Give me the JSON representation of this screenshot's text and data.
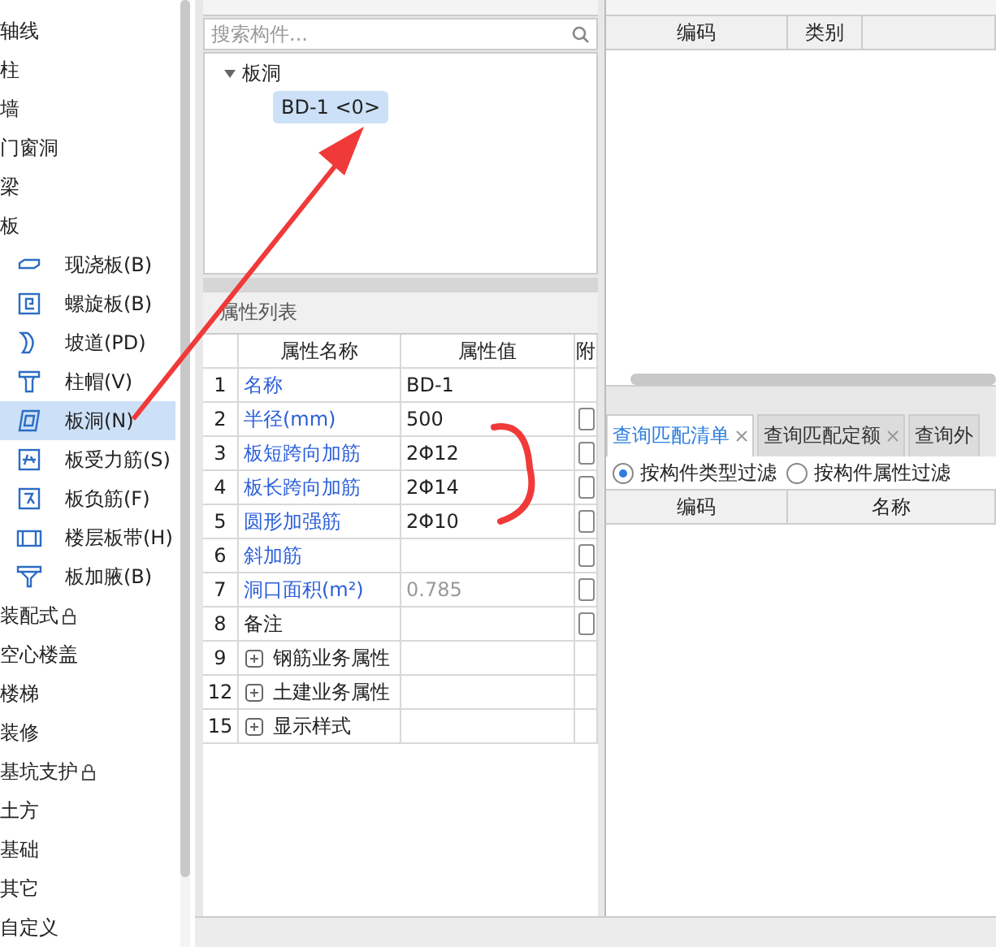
{
  "sidebar": {
    "items": [
      {
        "label": "轴线",
        "selected": false,
        "locked": false
      },
      {
        "label": "柱",
        "selected": false,
        "locked": false
      },
      {
        "label": "墙",
        "selected": false,
        "locked": false
      },
      {
        "label": "门窗洞",
        "selected": false,
        "locked": false
      },
      {
        "label": "梁",
        "selected": false,
        "locked": false
      },
      {
        "label": "板",
        "selected": false,
        "locked": false,
        "children": [
          {
            "label": "现浇板(B)",
            "selected": false
          },
          {
            "label": "螺旋板(B)",
            "selected": false
          },
          {
            "label": "坡道(PD)",
            "selected": false
          },
          {
            "label": "柱帽(V)",
            "selected": false
          },
          {
            "label": "板洞(N)",
            "selected": true
          },
          {
            "label": "板受力筋(S)",
            "selected": false
          },
          {
            "label": "板负筋(F)",
            "selected": false
          },
          {
            "label": "楼层板带(H)",
            "selected": false
          },
          {
            "label": "板加腋(B)",
            "selected": false
          }
        ]
      },
      {
        "label": "装配式",
        "selected": false,
        "locked": true
      },
      {
        "label": "空心楼盖",
        "selected": false,
        "locked": false
      },
      {
        "label": "楼梯",
        "selected": false,
        "locked": false
      },
      {
        "label": "装修",
        "selected": false,
        "locked": false
      },
      {
        "label": "基坑支护",
        "selected": false,
        "locked": true
      },
      {
        "label": "土方",
        "selected": false,
        "locked": false
      },
      {
        "label": "基础",
        "selected": false,
        "locked": false
      },
      {
        "label": "其它",
        "selected": false,
        "locked": false
      },
      {
        "label": "自定义",
        "selected": false,
        "locked": false
      }
    ]
  },
  "component_list": {
    "search": {
      "placeholder": "搜索构件..."
    },
    "tree": [
      {
        "label": "板洞",
        "expanded": true,
        "children": [
          {
            "label": "BD-1 <0>",
            "selected": true
          }
        ]
      }
    ]
  },
  "properties": {
    "title": "属性列表",
    "columns": [
      "属性名称",
      "属性值",
      "附"
    ],
    "rows": [
      {
        "kind": "property",
        "index": "1",
        "name": "名称",
        "value": "BD-1",
        "blue": true,
        "disabled": false,
        "has_checkbox": false
      },
      {
        "kind": "property",
        "index": "2",
        "name": "半径(mm)",
        "value": "500",
        "blue": true,
        "disabled": false,
        "has_checkbox": true,
        "checked": false
      },
      {
        "kind": "property",
        "index": "3",
        "name": "板短跨向加筋",
        "value": "2Φ12",
        "blue": true,
        "disabled": false,
        "has_checkbox": true,
        "checked": false
      },
      {
        "kind": "property",
        "index": "4",
        "name": "板长跨向加筋",
        "value": "2Φ14",
        "blue": true,
        "disabled": false,
        "has_checkbox": true,
        "checked": false
      },
      {
        "kind": "property",
        "index": "5",
        "name": "圆形加强筋",
        "value": "2Φ10",
        "blue": true,
        "disabled": false,
        "has_checkbox": true,
        "checked": false
      },
      {
        "kind": "property",
        "index": "6",
        "name": "斜加筋",
        "value": "",
        "blue": true,
        "disabled": false,
        "has_checkbox": true,
        "checked": false
      },
      {
        "kind": "property",
        "index": "7",
        "name": "洞口面积(m²)",
        "value": "0.785",
        "blue": true,
        "disabled": true,
        "has_checkbox": true,
        "checked": false
      },
      {
        "kind": "property",
        "index": "8",
        "name": "备注",
        "value": "",
        "blue": false,
        "disabled": false,
        "has_checkbox": true,
        "checked": false
      },
      {
        "kind": "group",
        "index": "9",
        "name": "钢筋业务属性",
        "expanded": false
      },
      {
        "kind": "group",
        "index": "12",
        "name": "土建业务属性",
        "expanded": false
      },
      {
        "kind": "group",
        "index": "15",
        "name": "显示样式",
        "expanded": false
      }
    ]
  },
  "list_table": {
    "columns": [
      "编码",
      "类别"
    ]
  },
  "query_tabs": [
    {
      "label": "查询匹配清单",
      "selected": true,
      "closable": true
    },
    {
      "label": "查询匹配定额",
      "selected": false,
      "closable": true
    },
    {
      "label": "查询外",
      "selected": false,
      "closable": false
    }
  ],
  "filters": [
    {
      "label": "按构件类型过滤",
      "selected": true
    },
    {
      "label": "按构件属性过滤",
      "selected": false
    }
  ],
  "query_table": {
    "columns": [
      "编码",
      "名称"
    ]
  }
}
